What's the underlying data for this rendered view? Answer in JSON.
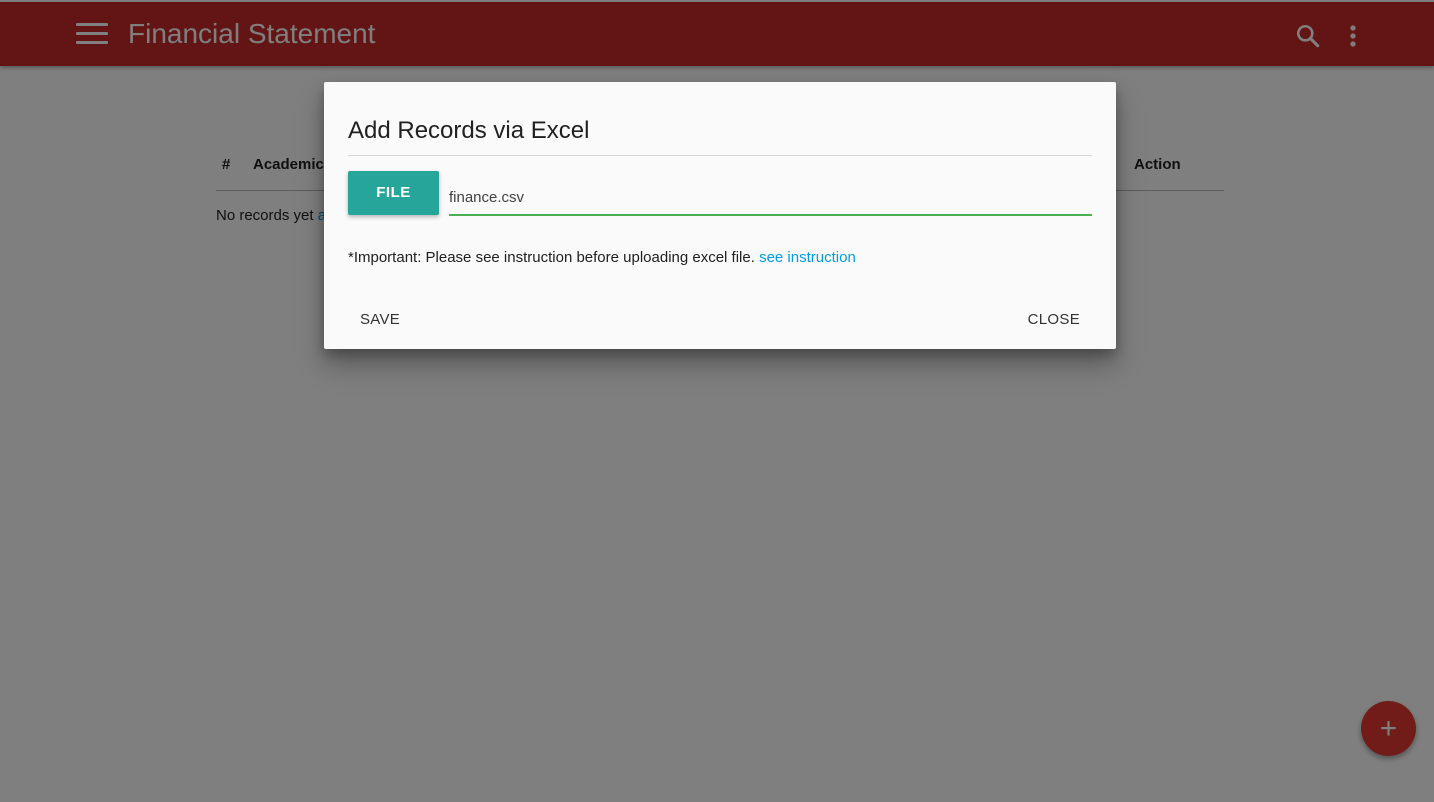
{
  "appbar": {
    "title": "Financial Statement",
    "menu_icon": "menu-icon",
    "search_icon": "search-icon",
    "more_icon": "more-vert-icon",
    "color": "#c62828"
  },
  "table": {
    "columns": [
      "#",
      "Academic",
      "Action"
    ],
    "empty_text": "No records yet ",
    "empty_link_visible": "a"
  },
  "fab": {
    "label": "+",
    "color": "#e53935"
  },
  "modal": {
    "title": "Add Records via Excel",
    "file_button_label": "FILE",
    "file_path_value": "finance.csv",
    "notice_text": "*Important: Please see instruction before uploading excel file. ",
    "notice_link": "see instruction",
    "save_label": "SAVE",
    "close_label": "CLOSE",
    "accent_color": "#26a69a",
    "input_underline_color": "#4caf50",
    "link_color": "#039be5"
  }
}
